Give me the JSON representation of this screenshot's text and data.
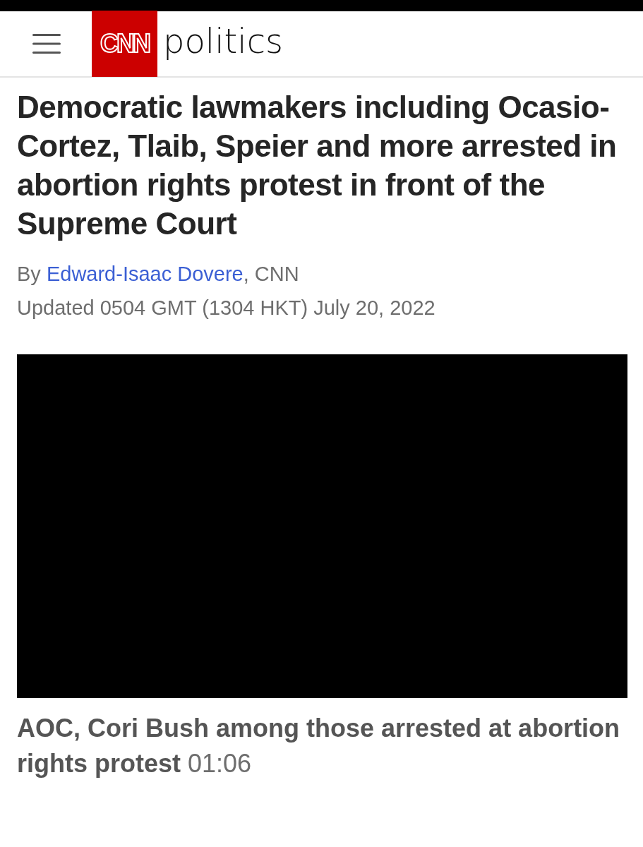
{
  "header": {
    "logo_mark": "CNN",
    "section": "politics"
  },
  "article": {
    "headline": "Democratic lawmakers including Ocasio-Cortez, Tlaib, Speier and more arrested in abortion rights protest in front of the Supreme Court",
    "byline_prefix": "By ",
    "author": "Edward-Isaac Dovere",
    "byline_suffix": ", CNN",
    "updated": "Updated 0504 GMT (1304 HKT) July 20, 2022"
  },
  "video": {
    "kind": "picture",
    "caption": "AOC, Cori Bush among those arrested at abortion rights protest",
    "duration": "01:06"
  }
}
